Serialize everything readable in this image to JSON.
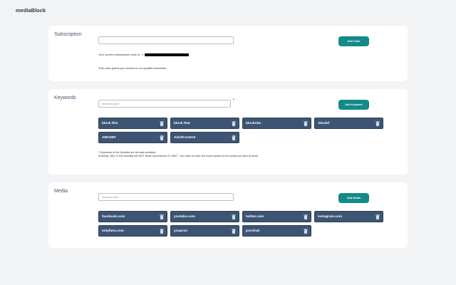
{
  "app": {
    "title": "mediaBlock"
  },
  "subscription": {
    "title": "Subscription",
    "code_value": "",
    "add_button": "Add Code",
    "status_text": "Your current subscription code is : 1",
    "info_text": "This code grants you access to our updated blocklists."
  },
  "keywords": {
    "title": "Keywords",
    "input_placeholder": "censored word",
    "asterisk": "*",
    "add_button": "Add Keyword",
    "items": [
      "block this",
      "block that",
      "blockAbc",
      "Abcdef",
      "ABCDEF",
      "AdultContent"
    ],
    "note_line1": "* Keywords in the blocklist are all case sensitive.",
    "note_line2": "Entering \"Abc\" in the blocklist will NOT block occurrences of \"ABC\". You have to enter the exact syntax of the words you wish to block."
  },
  "media": {
    "title": "Media",
    "input_placeholder": "censored word",
    "add_button": "Add Media",
    "items": [
      "facebook.com",
      "youtube.com",
      "twitter.com",
      "instagram.com",
      "onlyfans.com",
      "youpron",
      "pornhub"
    ]
  },
  "colors": {
    "accent": "#138a8a",
    "chip": "#3d5573",
    "card": "#ffffff",
    "background": "#f2f3f5"
  },
  "icons": {
    "chip_remove": "trash-icon"
  }
}
